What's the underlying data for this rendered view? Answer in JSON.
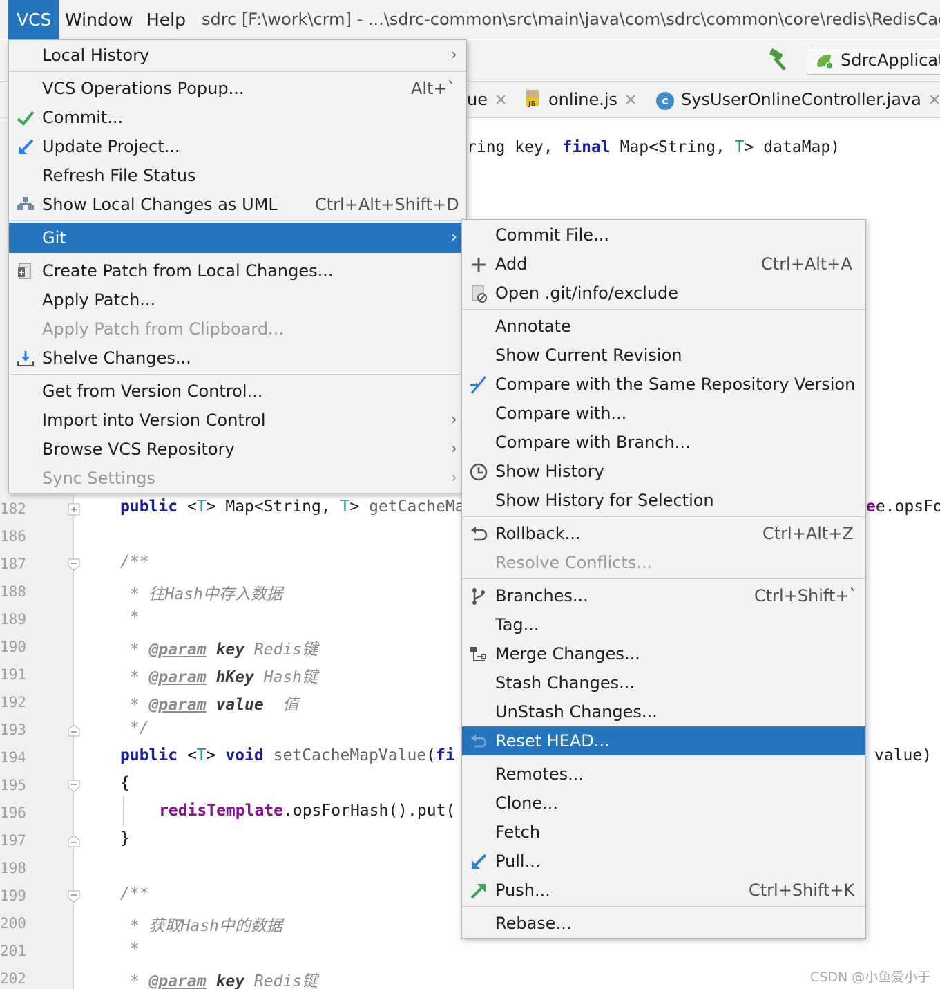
{
  "menubar": {
    "items": [
      "VCS",
      "Window",
      "Help"
    ],
    "title": "sdrc [F:\\work\\crm] - ...\\sdrc-common\\src\\main\\java\\com\\sdrc\\common\\core\\redis\\RedisCache"
  },
  "toolbar": {
    "run_config": "SdrcApplicat",
    "hammer_icon": "build-icon"
  },
  "tabs": [
    {
      "label": "ue",
      "close": "✕"
    },
    {
      "label": "online.js",
      "close": "✕"
    },
    {
      "label": "SysUserOnlineController.java",
      "close": "✕"
    }
  ],
  "editor": {
    "line_numbers": [
      "182",
      "186",
      "187",
      "188",
      "189",
      "190",
      "191",
      "192",
      "193",
      "194",
      "195",
      "196",
      "197",
      "198",
      "199",
      "200",
      "201",
      "202"
    ],
    "line_top_line": "ring key, final Map<String, T> dataMap)",
    "line_182_right": "e.opsFor",
    "line_194_right": "value)",
    "comments": {
      "c188": "往Hash中存入数据",
      "c190_param": "@param",
      "c190_name": "key",
      "c190_desc": "Redis键",
      "c191_param": "@param",
      "c191_name": "hKey",
      "c191_desc": "Hash键",
      "c192_param": "@param",
      "c192_name": "value",
      "c192_desc": "值",
      "c200": "获取Hash中的数据",
      "c202_param": "@param",
      "c202_name": "key",
      "c202_desc": "Redis键"
    }
  },
  "vcs_menu": {
    "items": [
      {
        "label": "Local History",
        "arrow": "›"
      },
      {
        "label": "VCS Operations Popup...",
        "shortcut": "Alt+`"
      },
      {
        "label": "Commit...",
        "icon": "check-icon"
      },
      {
        "label": "Update Project...",
        "icon": "update-arrow-icon"
      },
      {
        "label": "Refresh File Status"
      },
      {
        "label": "Show Local Changes as UML",
        "shortcut": "Ctrl+Alt+Shift+D",
        "icon": "uml-icon"
      },
      {
        "label": "Git",
        "arrow": "›",
        "selected": true
      },
      {
        "label": "Create Patch from Local Changes...",
        "icon": "patch-icon"
      },
      {
        "label": "Apply Patch..."
      },
      {
        "label": "Apply Patch from Clipboard...",
        "disabled": true
      },
      {
        "label": "Shelve Changes...",
        "icon": "shelve-icon"
      },
      {
        "label": "Get from Version Control..."
      },
      {
        "label": "Import into Version Control",
        "arrow": "›"
      },
      {
        "label": "Browse VCS Repository",
        "arrow": "›"
      },
      {
        "label": "Sync Settings",
        "arrow": "›",
        "disabled": true
      }
    ]
  },
  "git_menu": {
    "items": [
      {
        "label": "Commit File..."
      },
      {
        "label": "Add",
        "shortcut": "Ctrl+Alt+A",
        "icon": "plus-icon"
      },
      {
        "label": "Open .git/info/exclude",
        "icon": "exclude-file-icon"
      },
      {
        "label": "Annotate"
      },
      {
        "label": "Show Current Revision"
      },
      {
        "label": "Compare with the Same Repository Version",
        "icon": "compare-icon"
      },
      {
        "label": "Compare with..."
      },
      {
        "label": "Compare with Branch..."
      },
      {
        "label": "Show History",
        "icon": "clock-icon"
      },
      {
        "label": "Show History for Selection"
      },
      {
        "label": "Rollback...",
        "shortcut": "Ctrl+Alt+Z",
        "icon": "rollback-icon"
      },
      {
        "label": "Resolve Conflicts...",
        "disabled": true
      },
      {
        "label": "Branches...",
        "shortcut": "Ctrl+Shift+`",
        "icon": "branch-icon"
      },
      {
        "label": "Tag..."
      },
      {
        "label": "Merge Changes...",
        "icon": "merge-icon"
      },
      {
        "label": "Stash Changes..."
      },
      {
        "label": "UnStash Changes..."
      },
      {
        "label": "Reset HEAD...",
        "selected": true,
        "icon": "reset-icon"
      },
      {
        "label": "Remotes..."
      },
      {
        "label": "Clone..."
      },
      {
        "label": "Fetch"
      },
      {
        "label": "Pull...",
        "icon": "pull-icon"
      },
      {
        "label": "Push...",
        "shortcut": "Ctrl+Shift+K",
        "icon": "push-icon"
      },
      {
        "label": "Rebase..."
      }
    ]
  },
  "watermark": "CSDN @小鱼爱小于",
  "colors": {
    "selection": "#2675bf",
    "keyword": "#1c1c9c",
    "field": "#871094",
    "comment": "#8c8c8c"
  }
}
